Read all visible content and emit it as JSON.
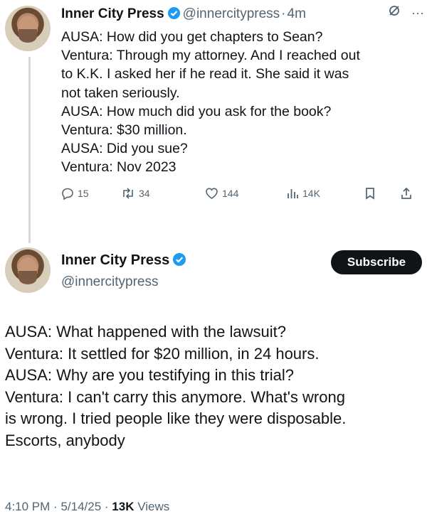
{
  "tweet1": {
    "author_name": "Inner City Press",
    "handle": "@innercitypress",
    "time": "4m",
    "lines": [
      "AUSA: How did you get chapters to Sean?",
      "Ventura: Through my attorney. And I reached out",
      "to K.K. I asked her if he read it. She said it was",
      "not taken seriously.",
      "AUSA: How much did you ask for the book?",
      "Ventura: $30 million.",
      "AUSA: Did you sue?",
      "Ventura: Nov 2023"
    ],
    "stats": {
      "replies": "15",
      "reposts": "34",
      "likes": "144",
      "views": "14K"
    },
    "more_glyph": "···"
  },
  "tweet2": {
    "author_name": "Inner City Press",
    "handle": "@innercitypress",
    "subscribe_label": "Subscribe",
    "lines": [
      "AUSA: What happened with the lawsuit?",
      "Ventura: It settled for $20 million, in 24 hours.",
      "AUSA: Why are you testifying in this trial?",
      "Ventura: I can't carry this anymore. What's wrong",
      "is wrong. I tried people like they were disposable.",
      "Escorts, anybody"
    ],
    "time": "4:10 PM",
    "date": "5/14/25",
    "views_count": "13K",
    "views_label": "Views"
  },
  "colors": {
    "verified": "#1d9bf0",
    "muted": "#536471",
    "text": "#0f1419",
    "button_bg": "#0f1419"
  }
}
